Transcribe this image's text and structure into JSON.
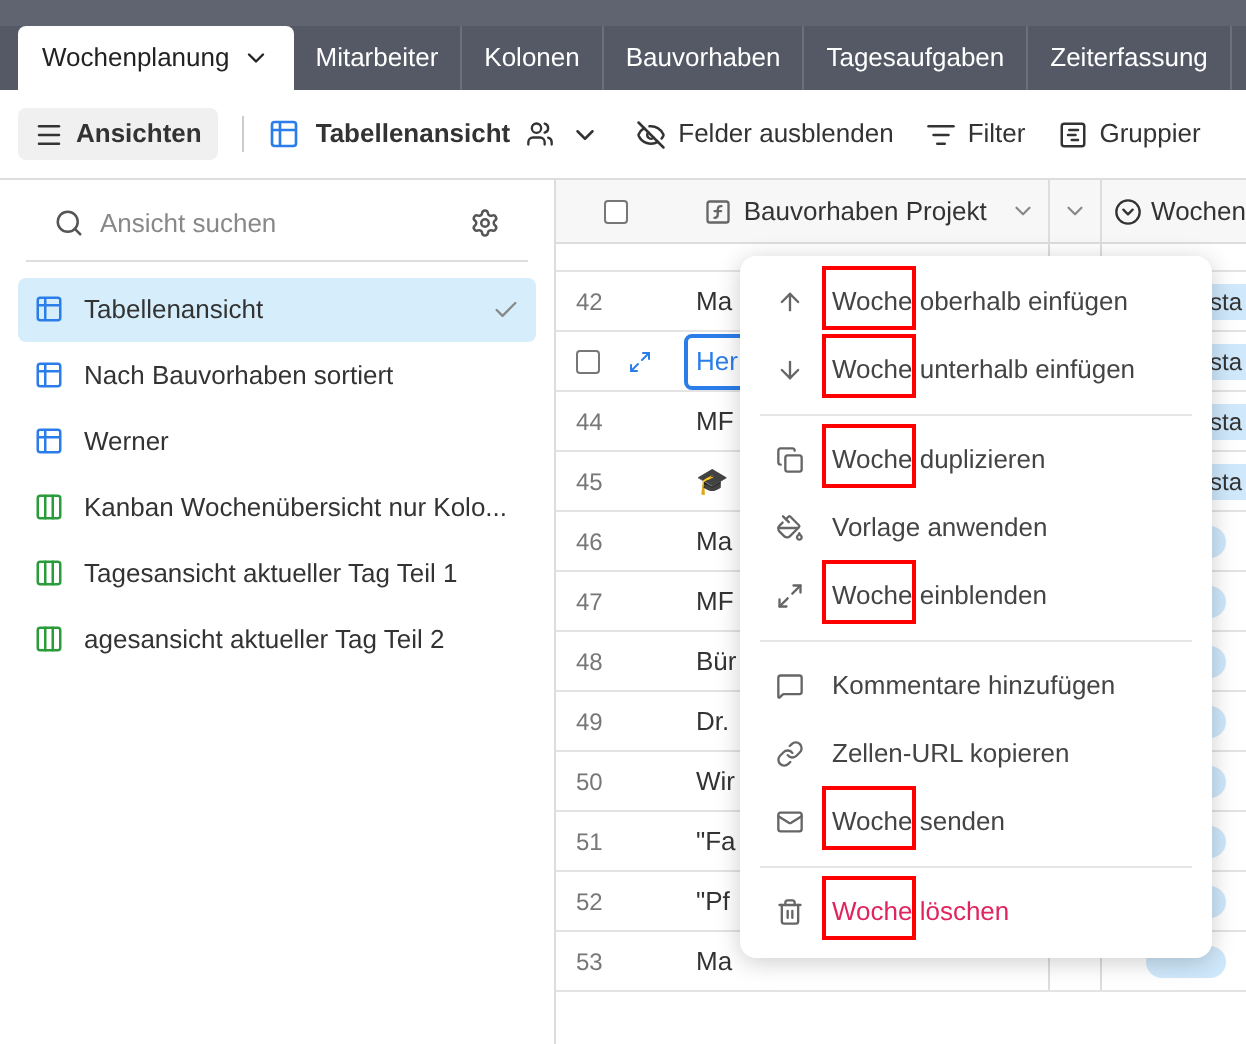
{
  "tabs": [
    {
      "label": "Wochenplanung",
      "selected": true
    },
    {
      "label": "Mitarbeiter",
      "selected": false
    },
    {
      "label": "Kolonen",
      "selected": false
    },
    {
      "label": "Bauvorhaben",
      "selected": false
    },
    {
      "label": "Tagesaufgaben",
      "selected": false
    },
    {
      "label": "Zeiterfassung",
      "selected": false
    }
  ],
  "toolbar": {
    "views_button": "Ansichten",
    "current_view": "Tabellenansicht",
    "hide_fields": "Felder ausblenden",
    "filter": "Filter",
    "group": "Gruppier"
  },
  "sidebar": {
    "search": {
      "placeholder": "Ansicht suchen"
    },
    "items": [
      {
        "label": "Tabellenansicht",
        "kind": "grid",
        "selected": true
      },
      {
        "label": "Nach Bauvorhaben sortiert",
        "kind": "grid",
        "selected": false
      },
      {
        "label": "Werner",
        "kind": "grid",
        "selected": false
      },
      {
        "label": "Kanban Wochenübersicht nur Kolo...",
        "kind": "kanban",
        "selected": false
      },
      {
        "label": "Tagesansicht aktueller Tag Teil 1",
        "kind": "kanban",
        "selected": false
      },
      {
        "label": "agesansicht aktueller Tag Teil 2",
        "kind": "kanban",
        "selected": false
      }
    ]
  },
  "table": {
    "select_all": {
      "checked": false
    },
    "columns": [
      {
        "label": "Bauvorhaben Projekt"
      },
      {
        "label": "Wochen"
      }
    ],
    "rows": [
      {
        "number": "42",
        "project": "Ma",
        "day": "sta",
        "selected": false
      },
      {
        "project": "Her",
        "day": "sta",
        "selected": true,
        "checked": false
      },
      {
        "number": "44",
        "project": "MF",
        "day": "sta",
        "selected": false
      },
      {
        "number": "45",
        "project": "🎓",
        "day": "sta",
        "selected": false
      },
      {
        "number": "46",
        "project": "Ma",
        "selected": false
      },
      {
        "number": "47",
        "project": "MF",
        "selected": false
      },
      {
        "number": "48",
        "project": "Bür",
        "selected": false
      },
      {
        "number": "49",
        "project": "Dr.",
        "selected": false
      },
      {
        "number": "50",
        "project": "Wir",
        "selected": false
      },
      {
        "number": "51",
        "project": "\"Fa",
        "selected": false
      },
      {
        "number": "52",
        "project": "\"Pf",
        "selected": false
      },
      {
        "number": "53",
        "project": "Ma",
        "selected": false
      }
    ]
  },
  "context_menu": {
    "groups": [
      [
        {
          "label": "Woche oberhalb einfügen",
          "kind": "up",
          "highlighted": true,
          "danger": false
        },
        {
          "label": "Woche unterhalb einfügen",
          "kind": "down",
          "highlighted": true,
          "danger": false
        }
      ],
      [
        {
          "label": "Woche duplizieren",
          "kind": "copy",
          "highlighted": true,
          "danger": false
        },
        {
          "label": "Vorlage anwenden",
          "kind": "template",
          "highlighted": false,
          "danger": false
        },
        {
          "label": "Woche einblenden",
          "kind": "expand",
          "highlighted": true,
          "danger": false
        }
      ],
      [
        {
          "label": "Kommentare hinzufügen",
          "kind": "comment",
          "highlighted": false,
          "danger": false
        },
        {
          "label": "Zellen-URL kopieren",
          "kind": "link",
          "highlighted": false,
          "danger": false
        },
        {
          "label": "Woche senden",
          "kind": "mail",
          "highlighted": true,
          "danger": false
        }
      ],
      [
        {
          "label": "Woche löschen",
          "kind": "trash",
          "highlighted": true,
          "danger": true
        }
      ]
    ]
  }
}
